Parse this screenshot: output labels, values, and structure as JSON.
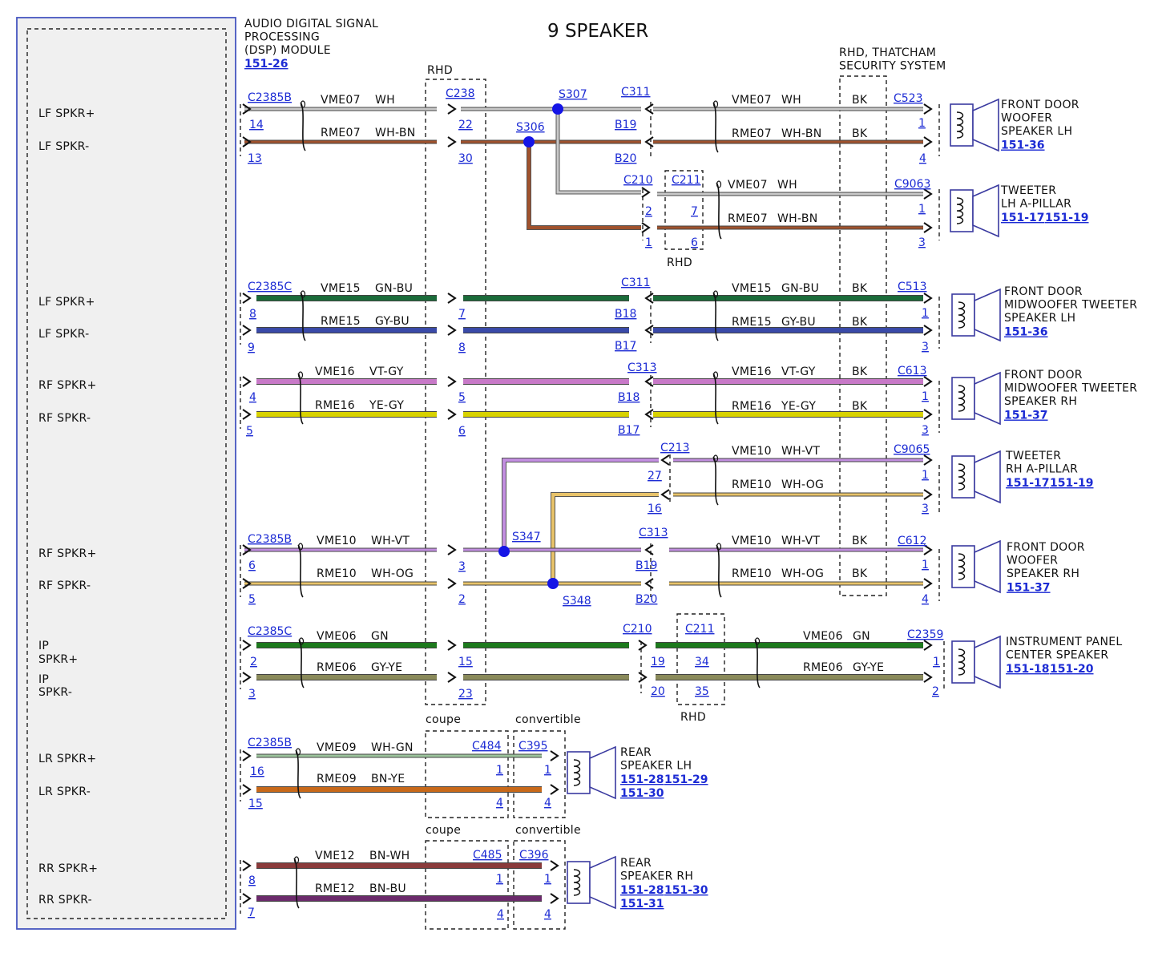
{
  "title": "9 SPEAKER",
  "module": {
    "name_lines": [
      "AUDIO DIGITAL SIGNAL",
      "PROCESSING",
      "(DSP) MODULE"
    ],
    "ref": "151-26",
    "pins": [
      {
        "lines": [
          "LF SPKR+"
        ]
      },
      {
        "lines": [
          "LF SPKR-"
        ]
      },
      {
        "lines": [
          "LF SPKR+"
        ]
      },
      {
        "lines": [
          "LF SPKR-"
        ]
      },
      {
        "lines": [
          "RF SPKR+"
        ]
      },
      {
        "lines": [
          "RF SPKR-"
        ]
      },
      {
        "lines": [
          "RF SPKR+"
        ]
      },
      {
        "lines": [
          "RF SPKR-"
        ]
      },
      {
        "lines": [
          "IP",
          "SPKR+"
        ]
      },
      {
        "lines": [
          "IP",
          "SPKR-"
        ]
      },
      {
        "lines": [
          "LR SPKR+"
        ]
      },
      {
        "lines": [
          "LR SPKR-"
        ]
      },
      {
        "lines": [
          "RR SPKR+"
        ]
      },
      {
        "lines": [
          "RR SPKR-"
        ]
      }
    ]
  },
  "colors": {
    "link": "#1c2bd4",
    "splice": "#1515e6",
    "WH": "#c8c8c8",
    "WH-BN": "#a0522d",
    "GN-BU": "#1b6b3a",
    "GY-BU": "#3a4aa8",
    "VT-GY": "#c879c8",
    "YE-GY": "#d8d200",
    "WH-VT": "#c28ee0",
    "WH-OG": "#e8c36a",
    "GN": "#1d7a1d",
    "GY-YE": "#8a8a5a",
    "WH-GN": "#9cc49c",
    "BN-YE": "#c8691a",
    "BN-WH": "#8a3b3b",
    "BN-BU": "#6b2a6b"
  },
  "labels": {
    "rhd": "RHD",
    "thatcham": [
      "RHD, THATCHAM",
      "SECURITY SYSTEM"
    ],
    "coupe": "coupe",
    "convertible": "convertible",
    "bk": "BK"
  },
  "connectors": {
    "c2385b": "C2385B",
    "c2385c": "C2385C",
    "c238": "C238",
    "c311": "C311",
    "c523": "C523",
    "c210": "C210",
    "c211": "C211",
    "c9063": "C9063",
    "c513": "C513",
    "c313": "C313",
    "c613": "C613",
    "c213": "C213",
    "c9065": "C9065",
    "c612": "C612",
    "c2359": "C2359",
    "c484": "C484",
    "c395": "C395",
    "c485": "C485",
    "c396": "C396"
  },
  "splices": {
    "s307": "S307",
    "s306": "S306",
    "s347": "S347",
    "s348": "S348"
  },
  "circuits": [
    {
      "circuit": "VME07",
      "color": "WH"
    },
    {
      "circuit": "RME07",
      "color": "WH-BN"
    },
    {
      "circuit": "VME15",
      "color": "GN-BU"
    },
    {
      "circuit": "RME15",
      "color": "GY-BU"
    },
    {
      "circuit": "VME16",
      "color": "VT-GY"
    },
    {
      "circuit": "RME16",
      "color": "YE-GY"
    },
    {
      "circuit": "VME10",
      "color": "WH-VT"
    },
    {
      "circuit": "RME10",
      "color": "WH-OG"
    },
    {
      "circuit": "VME06",
      "color": "GN"
    },
    {
      "circuit": "RME06",
      "color": "GY-YE"
    },
    {
      "circuit": "VME09",
      "color": "WH-GN"
    },
    {
      "circuit": "RME09",
      "color": "BN-YE"
    },
    {
      "circuit": "VME12",
      "color": "BN-WH"
    },
    {
      "circuit": "RME12",
      "color": "BN-BU"
    }
  ],
  "pins": {
    "p14": "14",
    "p13": "13",
    "p22": "22",
    "p30": "30",
    "pB19": "B19",
    "pB20": "B20",
    "p1": "1",
    "p4": "4",
    "p2": "2",
    "p7": "7",
    "p6": "6",
    "p3": "3",
    "p8": "8",
    "p9": "9",
    "pB18": "B18",
    "pB17": "B17",
    "p5": "5",
    "p27": "27",
    "p16": "16",
    "p23": "23",
    "p19": "19",
    "p34": "34",
    "p20": "20",
    "p35": "35",
    "p15": "15"
  },
  "speakers": [
    {
      "name_lines": [
        "FRONT DOOR",
        "WOOFER",
        "SPEAKER LH"
      ],
      "refs": [
        "151-36"
      ]
    },
    {
      "name_lines": [
        "TWEETER",
        "LH A-PILLAR"
      ],
      "refs": [
        "151-17",
        "151-19"
      ]
    },
    {
      "name_lines": [
        "FRONT DOOR",
        "MIDWOOFER TWEETER",
        "SPEAKER LH"
      ],
      "refs": [
        "151-36"
      ]
    },
    {
      "name_lines": [
        "FRONT DOOR",
        "MIDWOOFER TWEETER",
        "SPEAKER RH"
      ],
      "refs": [
        "151-37"
      ]
    },
    {
      "name_lines": [
        "TWEETER",
        "RH A-PILLAR"
      ],
      "refs": [
        "151-17",
        "151-19"
      ]
    },
    {
      "name_lines": [
        "FRONT DOOR",
        "WOOFER",
        "SPEAKER RH"
      ],
      "refs": [
        "151-37"
      ]
    },
    {
      "name_lines": [
        "INSTRUMENT PANEL",
        "CENTER SPEAKER"
      ],
      "refs": [
        "151-18",
        "151-20"
      ]
    },
    {
      "name_lines": [
        "REAR",
        "SPEAKER LH"
      ],
      "refs": [
        "151-28",
        "151-29",
        "151-30"
      ]
    },
    {
      "name_lines": [
        "REAR",
        "SPEAKER RH"
      ],
      "refs": [
        "151-28",
        "151-30",
        "151-31"
      ]
    }
  ]
}
